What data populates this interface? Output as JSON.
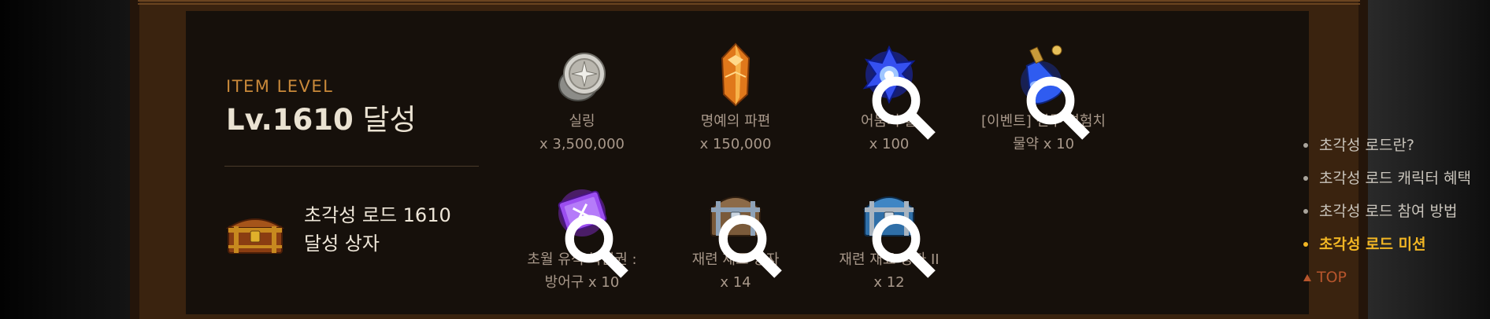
{
  "level": {
    "label": "ITEM LEVEL",
    "value": "Lv.1610",
    "suffix": "달성"
  },
  "chest": {
    "icon": "treasure-chest-icon",
    "title_line1": "초각성 로드 1610",
    "title_line2": "달성 상자"
  },
  "rewards": [
    {
      "icon": "silver-coin-icon",
      "name1": "실링",
      "name2": "",
      "qty": "x 3,500,000",
      "zoomable": false
    },
    {
      "icon": "honor-shard-icon",
      "name1": "명예의 파편",
      "name2": "",
      "qty": "x 150,000",
      "zoomable": false
    },
    {
      "icon": "dark-fire-icon",
      "name1": "어둠의 불",
      "name2": "",
      "qty": "x 100",
      "zoomable": true
    },
    {
      "icon": "exp-potion-icon",
      "name1": "[이벤트] 전투 경험치",
      "name2": "물약 x 10",
      "qty": "",
      "zoomable": true
    },
    {
      "icon": "restore-ticket-icon",
      "name1": "초월 유적 복원권 :",
      "name2": "방어구 x 10",
      "qty": "",
      "zoomable": true
    },
    {
      "icon": "material-chest-icon",
      "name1": "재련 재료 상자",
      "name2": "",
      "qty": "x 14",
      "zoomable": true
    },
    {
      "icon": "material-chest-2-icon",
      "name1": "재련 재료 상자 II",
      "name2": "",
      "qty": "x 12",
      "zoomable": true
    }
  ],
  "nav": {
    "items": [
      {
        "label": "초각성 로드란?",
        "active": false
      },
      {
        "label": "초각성 로드 캐릭터 혜택",
        "active": false
      },
      {
        "label": "초각성 로드 참여 방법",
        "active": false
      },
      {
        "label": "초각성 로드 미션",
        "active": true
      }
    ],
    "top_label": "TOP"
  },
  "colors": {
    "accent_gold": "#c9893a",
    "active_nav": "#f2b624",
    "top_link": "#b7552c",
    "panel_bg": "#16100b",
    "frame_bg": "#3a230f"
  }
}
